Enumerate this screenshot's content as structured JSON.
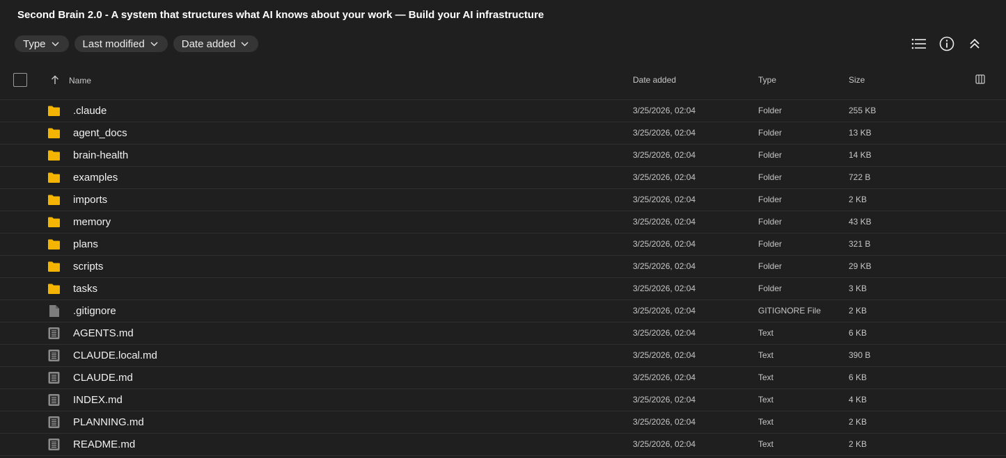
{
  "title": "Second Brain 2.0 - A system that structures what AI knows about your work — Build your AI infrastructure",
  "filters": {
    "type_label": "Type",
    "last_modified_label": "Last modified",
    "date_added_label": "Date added"
  },
  "toolbar_icons": [
    "list-view-icon",
    "info-icon",
    "collapse-icon"
  ],
  "columns": {
    "name": "Name",
    "date_added": "Date added",
    "type": "Type",
    "size": "Size"
  },
  "colors": {
    "background": "#1f1f1f",
    "folder": "#f5b400",
    "file": "#7d7d7d",
    "divider": "#2e2e2e"
  },
  "files": [
    {
      "name": ".claude",
      "date": "3/25/2026, 02:04",
      "type": "Folder",
      "size": "255 KB",
      "icon": "folder"
    },
    {
      "name": "agent_docs",
      "date": "3/25/2026, 02:04",
      "type": "Folder",
      "size": "13 KB",
      "icon": "folder"
    },
    {
      "name": "brain-health",
      "date": "3/25/2026, 02:04",
      "type": "Folder",
      "size": "14 KB",
      "icon": "folder"
    },
    {
      "name": "examples",
      "date": "3/25/2026, 02:04",
      "type": "Folder",
      "size": "722 B",
      "icon": "folder"
    },
    {
      "name": "imports",
      "date": "3/25/2026, 02:04",
      "type": "Folder",
      "size": "2 KB",
      "icon": "folder"
    },
    {
      "name": "memory",
      "date": "3/25/2026, 02:04",
      "type": "Folder",
      "size": "43 KB",
      "icon": "folder"
    },
    {
      "name": "plans",
      "date": "3/25/2026, 02:04",
      "type": "Folder",
      "size": "321 B",
      "icon": "folder"
    },
    {
      "name": "scripts",
      "date": "3/25/2026, 02:04",
      "type": "Folder",
      "size": "29 KB",
      "icon": "folder"
    },
    {
      "name": "tasks",
      "date": "3/25/2026, 02:04",
      "type": "Folder",
      "size": "3 KB",
      "icon": "folder"
    },
    {
      "name": ".gitignore",
      "date": "3/25/2026, 02:04",
      "type": "GITIGNORE File",
      "size": "2 KB",
      "icon": "file"
    },
    {
      "name": "AGENTS.md",
      "date": "3/25/2026, 02:04",
      "type": "Text",
      "size": "6 KB",
      "icon": "text"
    },
    {
      "name": "CLAUDE.local.md",
      "date": "3/25/2026, 02:04",
      "type": "Text",
      "size": "390 B",
      "icon": "text"
    },
    {
      "name": "CLAUDE.md",
      "date": "3/25/2026, 02:04",
      "type": "Text",
      "size": "6 KB",
      "icon": "text"
    },
    {
      "name": "INDEX.md",
      "date": "3/25/2026, 02:04",
      "type": "Text",
      "size": "4 KB",
      "icon": "text"
    },
    {
      "name": "PLANNING.md",
      "date": "3/25/2026, 02:04",
      "type": "Text",
      "size": "2 KB",
      "icon": "text"
    },
    {
      "name": "README.md",
      "date": "3/25/2026, 02:04",
      "type": "Text",
      "size": "2 KB",
      "icon": "text"
    }
  ]
}
